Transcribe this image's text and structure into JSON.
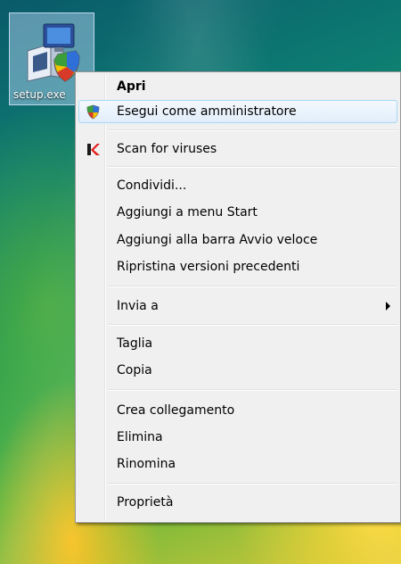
{
  "desktop_icon": {
    "label": "setup.exe",
    "icon": "setup-installer-icon"
  },
  "menu": {
    "items": [
      {
        "label": "Apri",
        "default": true
      },
      {
        "label": "Esegui come amministratore",
        "icon": "uac-shield-icon",
        "highlighted": true
      },
      {
        "label": "Scan for viruses",
        "icon": "kaspersky-k-icon"
      },
      {
        "label": "Condividi..."
      },
      {
        "label": "Aggiungi a menu Start"
      },
      {
        "label": "Aggiungi alla barra Avvio veloce"
      },
      {
        "label": "Ripristina versioni precedenti"
      },
      {
        "label": "Invia a",
        "submenu": true
      },
      {
        "label": "Taglia"
      },
      {
        "label": "Copia"
      },
      {
        "label": "Crea collegamento"
      },
      {
        "label": "Elimina"
      },
      {
        "label": "Rinomina"
      },
      {
        "label": "Proprietà"
      }
    ]
  },
  "colors": {
    "highlight_border": "#a8d8f6",
    "menu_background": "#f0f0f0"
  }
}
